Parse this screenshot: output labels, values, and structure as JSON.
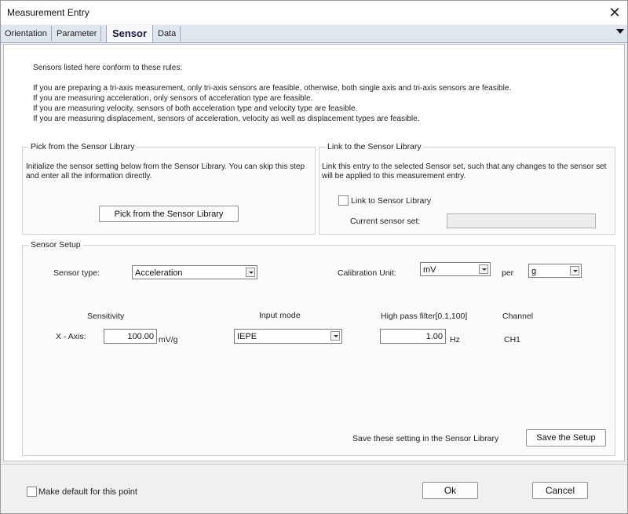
{
  "window": {
    "title": "Measurement Entry"
  },
  "tabs": [
    {
      "label": "Orientation"
    },
    {
      "label": "Parameter"
    },
    {
      "label": "Sensor"
    },
    {
      "label": "Data"
    }
  ],
  "rules": {
    "intro": "Sensors listed here conform to these rules:",
    "lines": [
      "If you are preparing a tri-axis measurement, only tri-axis sensors are feasible, otherwise, both single axis and tri-axis sensors are feasible.",
      "If you are measuring acceleration, only sensors of acceleration type are feasible.",
      "If you are measuring velocity, sensors of both acceleration type and velocity type are feasible.",
      "If you are measuring displacement, sensors of acceleration, velocity as well as displacement types are feasible."
    ]
  },
  "pick": {
    "title": "Pick from the Sensor Library",
    "description": "Initialize the sensor setting below from the Sensor Library. You can skip this step and enter all the information directly.",
    "button_label": "Pick from the Sensor Library"
  },
  "link": {
    "title": "Link to the Sensor Library",
    "description": "Link this entry to the selected Sensor set, such that any changes to the sensor set will be applied to this measurement entry.",
    "checkbox_label": "Link to Sensor Library",
    "current_set_label": "Current sensor set:",
    "current_set_value": ""
  },
  "setup": {
    "title": "Sensor Setup",
    "sensor_type_label": "Sensor type:",
    "sensor_type_value": "Acceleration",
    "calibration_label": "Calibration Unit:",
    "calibration_value": "mV",
    "per_label": "per",
    "per_value": "g",
    "col_sensitivity": "Sensitivity",
    "col_input_mode": "Input mode",
    "col_high_pass": "High pass filter[0.1,100]",
    "col_channel": "Channel",
    "axis_label": "X - Axis:",
    "sensitivity_value": "100.00",
    "sensitivity_unit": "mV/g",
    "input_mode_value": "IEPE",
    "high_pass_value": "1.00",
    "high_pass_unit": "Hz",
    "channel_value": "CH1",
    "save_text": "Save these setting in the Sensor Library",
    "save_button": "Save the Setup"
  },
  "footer": {
    "default_label": "Make default for this point",
    "ok_label": "Ok",
    "cancel_label": "Cancel"
  }
}
